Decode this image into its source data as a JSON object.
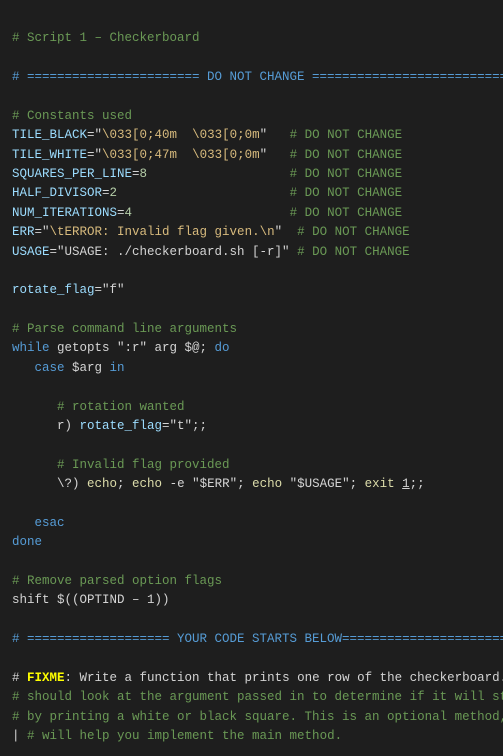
{
  "title": "Script 1 - Checkerboard",
  "lines": [
    {
      "type": "comment",
      "content": "# Script 1 – Checkerboard"
    },
    {
      "type": "blank"
    },
    {
      "type": "divider",
      "content": "# ======================= DO NOT CHANGE =========================== #"
    },
    {
      "type": "blank"
    },
    {
      "type": "comment",
      "content": "# Constants used"
    },
    {
      "type": "code_comment",
      "content": "TILE_BLACK=\"\\033[0;40m  \\033[0;0m\"   # DO NOT CHANGE"
    },
    {
      "type": "code_comment",
      "content": "TILE_WHITE=\"\\033[0;47m  \\033[0;0m\"   # DO NOT CHANGE"
    },
    {
      "type": "code_comment",
      "content": "SQUARES_PER_LINE=8                   # DO NOT CHANGE"
    },
    {
      "type": "code_comment",
      "content": "HALF_DIVISOR=2                       # DO NOT CHANGE"
    },
    {
      "type": "code_comment",
      "content": "NUM_ITERATIONS=4                     # DO NOT CHANGE"
    },
    {
      "type": "code_comment",
      "content": "ERR=\"\\tERROR: Invalid flag given.\\n\"  # DO NOT CHANGE"
    },
    {
      "type": "code_comment",
      "content": "USAGE=\"USAGE: ./checkerboard.sh [-r]\" # DO NOT CHANGE"
    },
    {
      "type": "blank"
    },
    {
      "type": "plain",
      "content": "rotate_flag=\"f\""
    },
    {
      "type": "blank"
    },
    {
      "type": "comment",
      "content": "# Parse command line arguments"
    },
    {
      "type": "plain",
      "content": "while getopts \":r\" arg $@; do"
    },
    {
      "type": "plain",
      "content": "   case $arg in"
    },
    {
      "type": "blank"
    },
    {
      "type": "comment_indent",
      "content": "      # rotation wanted"
    },
    {
      "type": "plain_indent",
      "content": "      r) rotate_flag=\"t\";;"
    },
    {
      "type": "blank"
    },
    {
      "type": "comment_indent",
      "content": "      # Invalid flag provided"
    },
    {
      "type": "plain_indent",
      "content": "      \\?) echo; echo -e \"$ERR\"; echo \"$USAGE\"; exit 1;;"
    },
    {
      "type": "blank"
    },
    {
      "type": "plain",
      "content": "   esac"
    },
    {
      "type": "plain",
      "content": "done"
    },
    {
      "type": "blank"
    },
    {
      "type": "comment",
      "content": "# Remove parsed option flags"
    },
    {
      "type": "plain",
      "content": "shift $((OPTIND – 1))"
    },
    {
      "type": "blank"
    },
    {
      "type": "divider2",
      "content": "# =================== YOUR CODE STARTS BELOW======================= #"
    },
    {
      "type": "blank"
    },
    {
      "type": "fixme",
      "content_prefix": "# ",
      "fixme_word": "FIXME",
      "content_suffix": ": Write a function that prints one row of the checkerboard. It"
    },
    {
      "type": "comment_wrap",
      "content": "# should look at the argument passed in to determine if it will start"
    },
    {
      "type": "comment_wrap",
      "content": "# by printing a white or black square. This is an optional method, but"
    },
    {
      "type": "comment_pipe",
      "content": "| # will help you implement the main method."
    }
  ]
}
